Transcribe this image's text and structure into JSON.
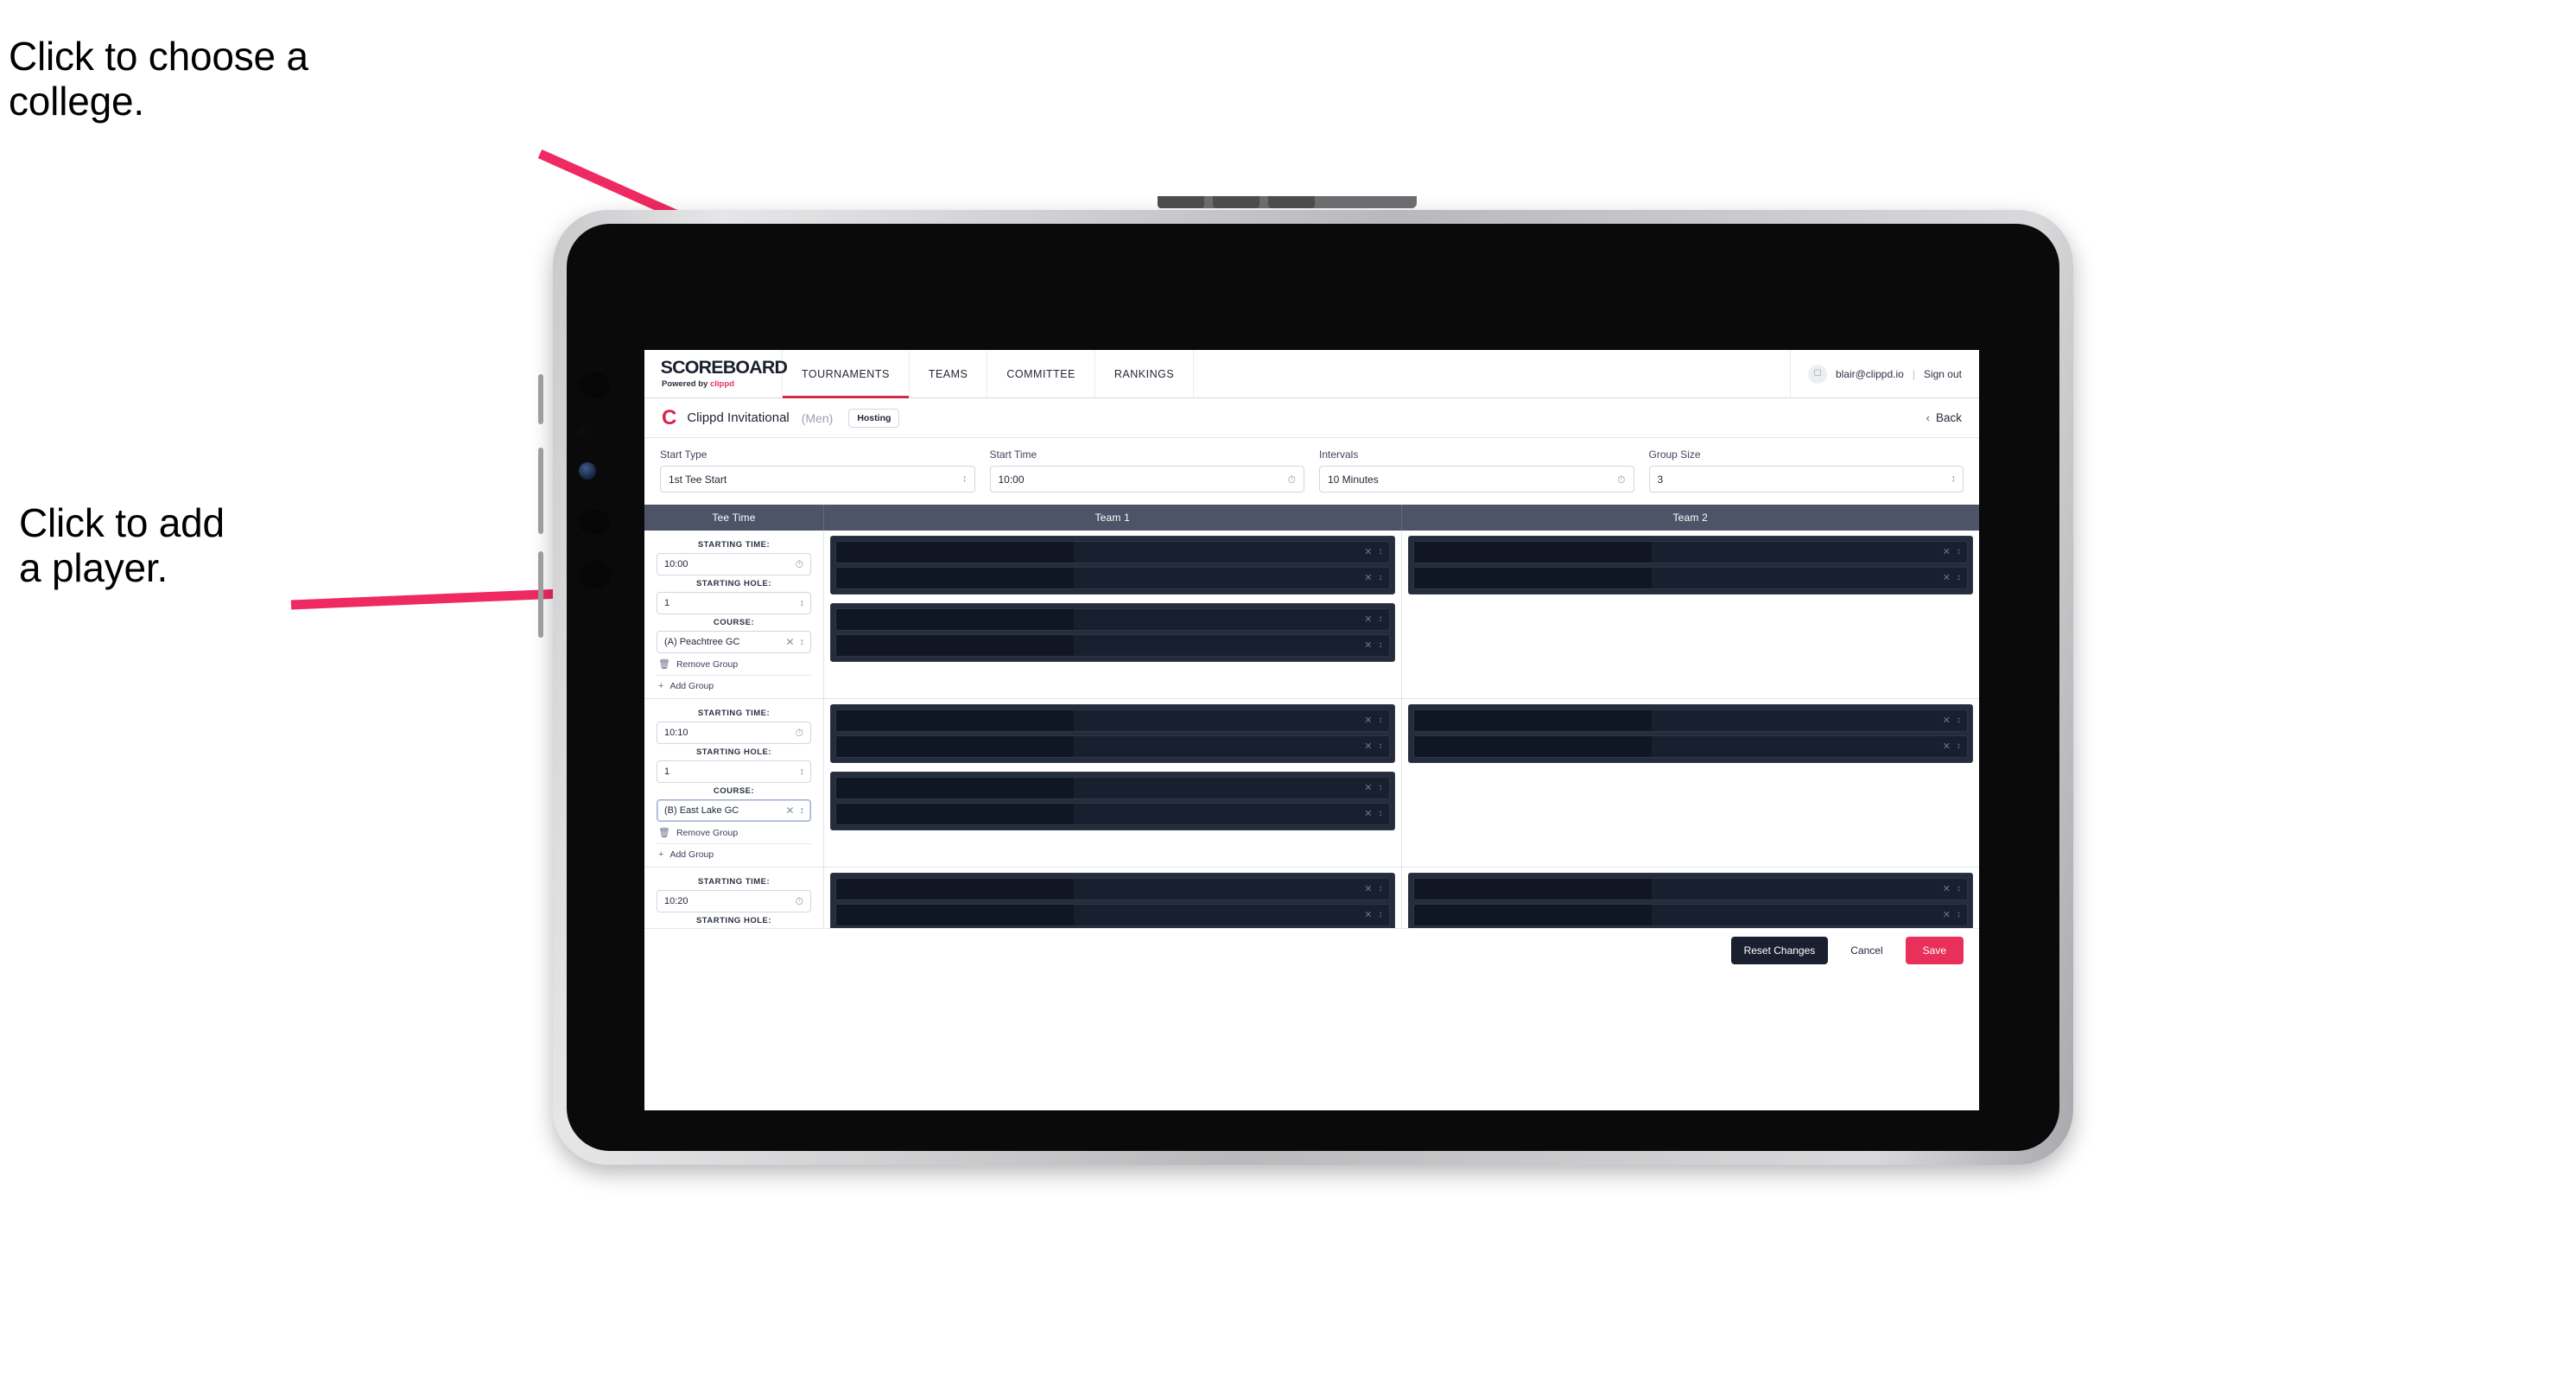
{
  "annotations": {
    "college": "Click to choose a\ncollege.",
    "player": "Click to add\na player.",
    "arrow_color": "#e8305a"
  },
  "brand": {
    "wordmark": "SCOREBOARD",
    "powered_prefix": "Powered by ",
    "powered_name": "clippd"
  },
  "nav": {
    "tabs": [
      {
        "label": "TOURNAMENTS",
        "active": true
      },
      {
        "label": "TEAMS",
        "active": false
      },
      {
        "label": "COMMITTEE",
        "active": false
      },
      {
        "label": "RANKINGS",
        "active": false
      }
    ],
    "user_email": "blair@clippd.io",
    "separator": "|",
    "sign_out": "Sign out",
    "avatar_icon": "user-avatar-icon",
    "active_underline_color": "#d32a48"
  },
  "tournament": {
    "logo_letter": "C",
    "name": "Clippd Invitational",
    "gender": "(Men)",
    "status_chip": "Hosting",
    "back_label": "Back",
    "back_chevron": "‹"
  },
  "settings": [
    {
      "label": "Start Type",
      "value": "1st Tee Start",
      "icon": "stepper-icon"
    },
    {
      "label": "Start Time",
      "value": "10:00",
      "icon": "clock-icon"
    },
    {
      "label": "Intervals",
      "value": "10 Minutes",
      "icon": "clock-icon"
    },
    {
      "label": "Group Size",
      "value": "3",
      "icon": "stepper-icon"
    }
  ],
  "table": {
    "header_bg": "#4d5467",
    "columns": [
      "Tee Time",
      "Team 1",
      "Team 2"
    ]
  },
  "labels": {
    "starting_time": "STARTING TIME:",
    "starting_hole": "STARTING HOLE:",
    "course": "COURSE:",
    "remove_group": "Remove Group",
    "add_group": "Add Group",
    "clock_icon": "clock-icon",
    "stepper_icon": "stepper-icon",
    "clear_icon": "clear-x-icon",
    "trash_icon": "trash-icon",
    "plus_icon": "plus-icon"
  },
  "groups": [
    {
      "starting_time": "10:00",
      "starting_hole": "1",
      "course": "(A) Peachtree GC",
      "course_focused": false,
      "team1": [
        {
          "players": 2
        },
        {
          "players": 2
        }
      ],
      "team2": [
        {
          "players": 2
        }
      ]
    },
    {
      "starting_time": "10:10",
      "starting_hole": "1",
      "course": "(B) East Lake GC",
      "course_focused": true,
      "team1": [
        {
          "players": 2
        },
        {
          "players": 2
        }
      ],
      "team2": [
        {
          "players": 2
        }
      ]
    },
    {
      "starting_time": "10:20",
      "starting_hole": "",
      "course": "",
      "course_focused": false,
      "team1": [
        {
          "players": 2
        }
      ],
      "team2": [
        {
          "players": 2
        }
      ]
    }
  ],
  "footer": {
    "reset": "Reset Changes",
    "cancel": "Cancel",
    "save": "Save",
    "save_color": "#e8305a"
  }
}
